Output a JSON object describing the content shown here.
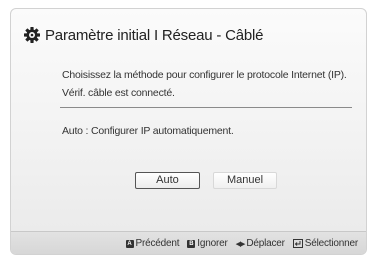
{
  "dialog": {
    "title": "Paramètre initial I Réseau - Câblé",
    "icon": "gear-icon",
    "description_line1": "Choisissez la méthode pour configurer le protocole Internet (IP).",
    "description_line2": "Vérif. câble est connecté.",
    "auto_description": "Auto : Configurer IP automatiquement."
  },
  "buttons": {
    "auto_label": "Auto",
    "manual_label": "Manuel"
  },
  "footer": {
    "previous_key": "A",
    "previous_label": "Précédent",
    "ignore_key": "B",
    "ignore_label": "Ignorer",
    "move_label": "Déplacer",
    "select_label": "Sélectionner"
  }
}
